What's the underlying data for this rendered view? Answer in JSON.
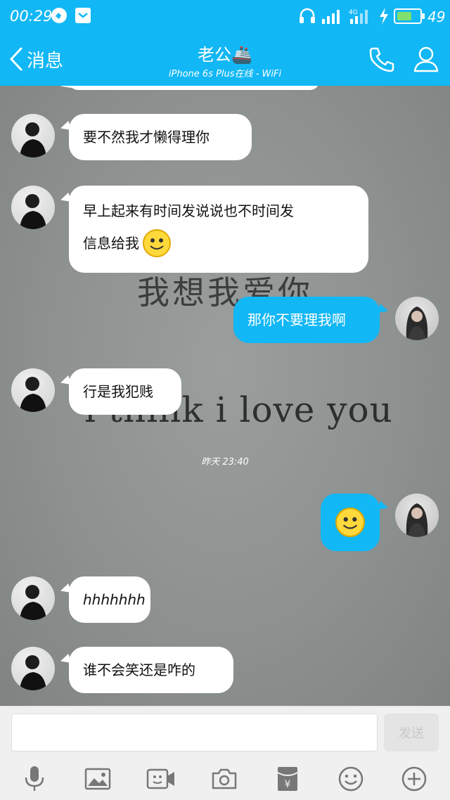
{
  "status_bar": {
    "time": "00:29",
    "battery": "49",
    "signal_label": "4G"
  },
  "header": {
    "back_label": "消息",
    "title": "老公🚢",
    "subtitle": "iPhone 6s Plus在线 - WiFi"
  },
  "background_text": {
    "chinese": "我想我爱你",
    "english": "i think i love you"
  },
  "messages": [
    {
      "side": "left",
      "text": "要不然我才懒得理你"
    },
    {
      "side": "left",
      "line1": "早上起来有时间发说说也不时间发",
      "line2": "信息给我",
      "emoji": "smile"
    },
    {
      "side": "right",
      "text": "那你不要理我啊"
    },
    {
      "side": "left",
      "text": "行是我犯贱"
    },
    {
      "side": "right",
      "emoji": "smile"
    },
    {
      "side": "left",
      "text": "hhhhhhh"
    },
    {
      "side": "left",
      "text": "谁不会笑还是咋的"
    }
  ],
  "timestamp": "昨天 23:40",
  "composer": {
    "placeholder": "",
    "send_label": "发送"
  },
  "toolbar": [
    "mic-icon",
    "image-icon",
    "video-icon",
    "camera-icon",
    "red-packet-icon",
    "emoji-icon",
    "plus-icon"
  ],
  "colors": {
    "accent": "#12b7f5",
    "bubble_left": "#ffffff",
    "bubble_right": "#12b7f5"
  }
}
